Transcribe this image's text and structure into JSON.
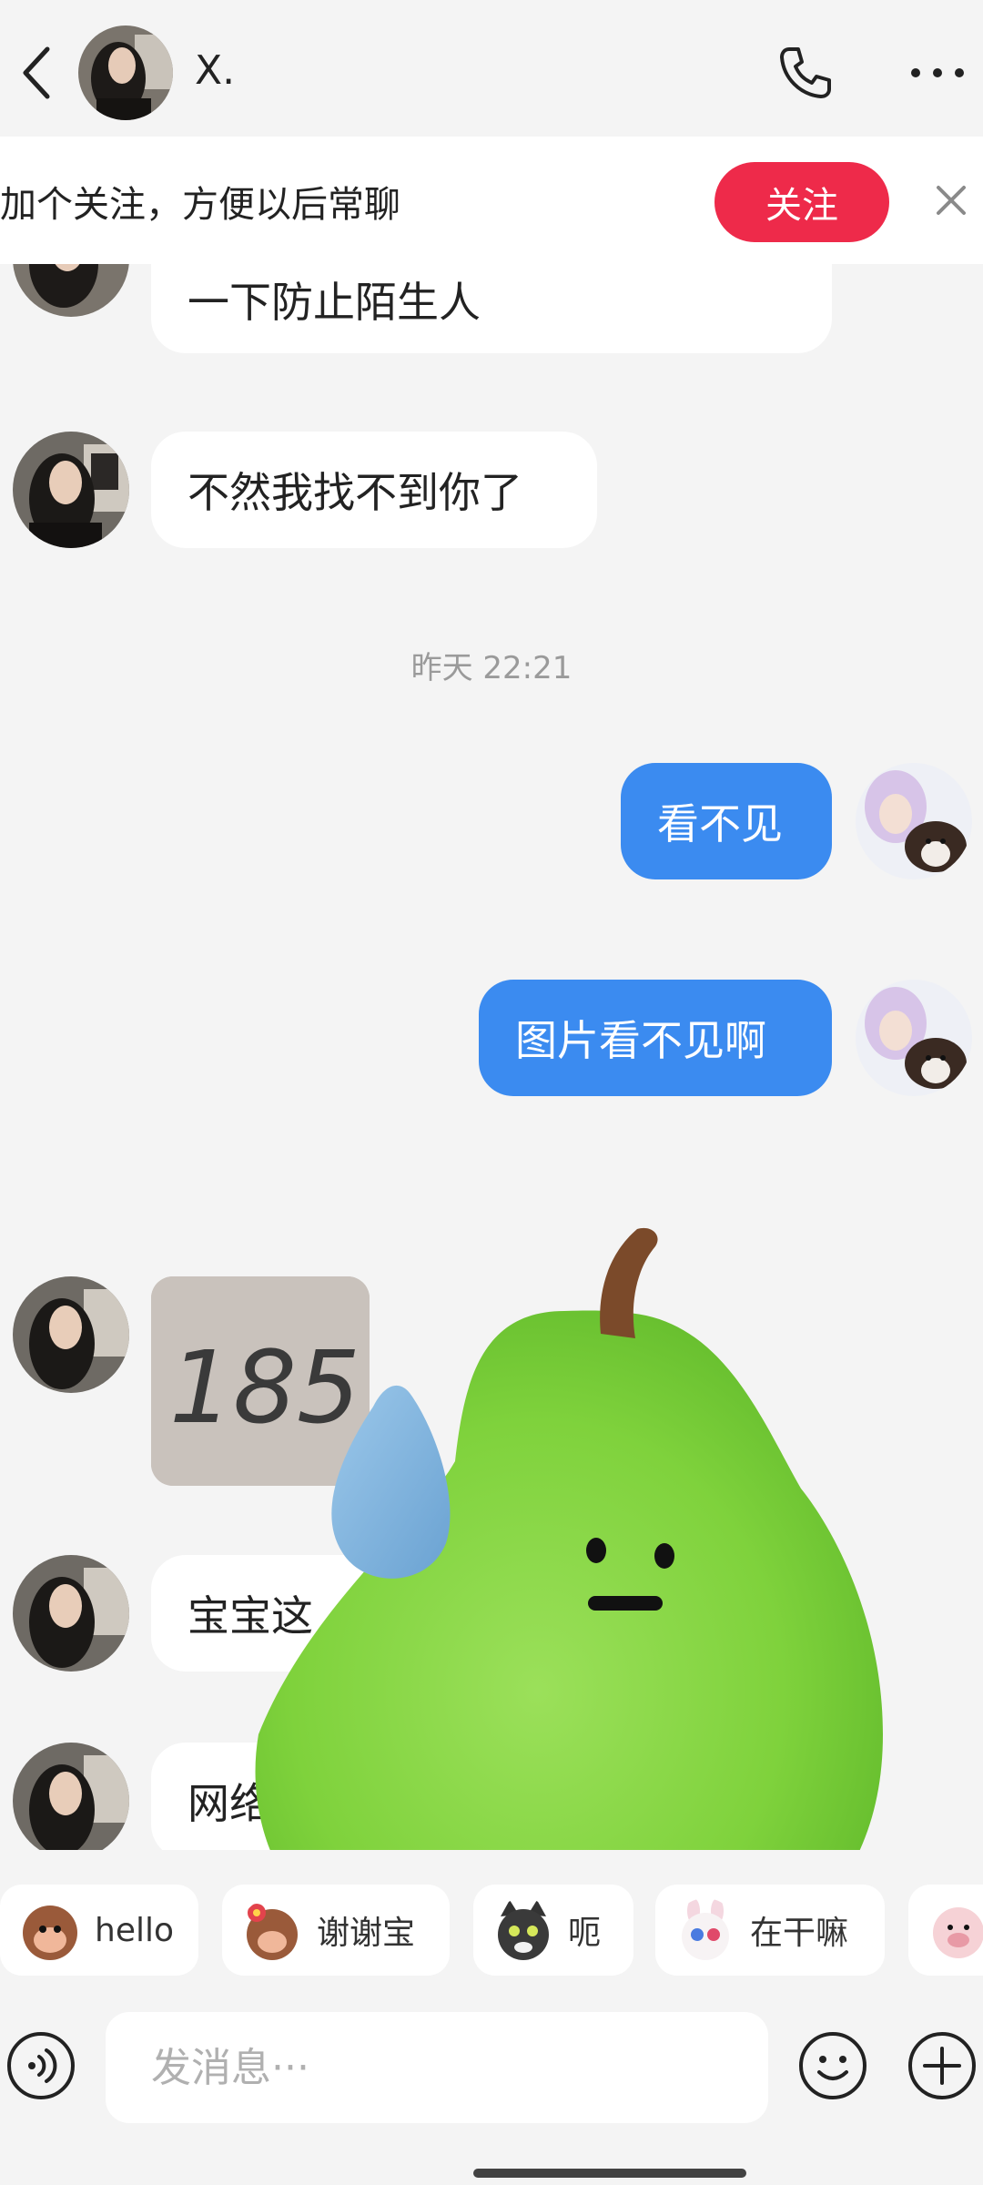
{
  "header": {
    "contact_name": "X.",
    "icons": {
      "back": "chevron-left-icon",
      "call": "phone-icon",
      "more": "more-dots-icon"
    }
  },
  "follow_banner": {
    "text": "加个关注，方便以后常聊",
    "button_label": "关注",
    "button_color": "#ee2a4a"
  },
  "messages": [
    {
      "side": "in",
      "text": "一下防止陌生人"
    },
    {
      "side": "in",
      "text": "不然我找不到你了"
    },
    {
      "side": "time",
      "text": "昨天 22:21"
    },
    {
      "side": "out",
      "text": "看不见"
    },
    {
      "side": "out",
      "text": "图片看不见啊"
    },
    {
      "side": "in",
      "type": "photo",
      "handwriting": "185"
    },
    {
      "side": "in",
      "text": "宝宝这"
    },
    {
      "side": "in",
      "text": "网络不太好"
    }
  ],
  "quick_replies": [
    {
      "label": "hello",
      "icon": "monkey-emoji-icon"
    },
    {
      "label": "谢谢宝",
      "icon": "monkey-flower-emoji-icon"
    },
    {
      "label": "呃",
      "icon": "cat-emoji-icon"
    },
    {
      "label": "在干嘛",
      "icon": "bunny-emoji-icon"
    },
    {
      "label": "",
      "icon": "pig-emoji-icon"
    }
  ],
  "input": {
    "placeholder": "发消息···",
    "icons": {
      "voice": "voice-icon",
      "emoji": "smiley-icon",
      "plus": "plus-icon"
    }
  },
  "colors": {
    "background": "#f4f4f4",
    "outgoing_bubble": "#3b8bf0",
    "incoming_bubble": "#ffffff",
    "pear": "#7fd23c",
    "sweat_drop": "#7fb2dc"
  }
}
